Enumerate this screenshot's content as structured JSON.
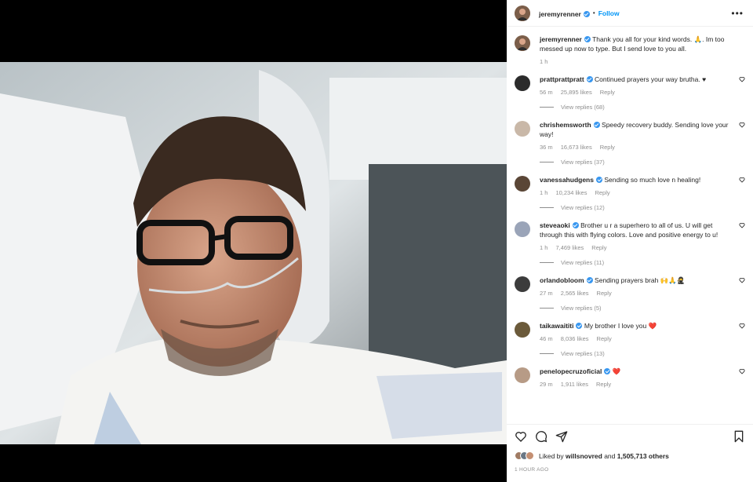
{
  "post": {
    "username": "jeremyrenner",
    "follow_label": "Follow",
    "separator": "•",
    "more_label": "•••",
    "caption": "Thank you all for your kind words. 🙏. Im too messed up now to type. But I send love to you all.",
    "caption_time": "1 h"
  },
  "comments": [
    {
      "user": "prattprattpratt",
      "text": "Continued prayers your way brutha. ♥",
      "time": "56 m",
      "likes": "25,895 likes",
      "reply": "Reply",
      "view_replies": "View replies (68)"
    },
    {
      "user": "chrishemsworth",
      "text": "Speedy recovery buddy. Sending love your way!",
      "time": "36 m",
      "likes": "16,673 likes",
      "reply": "Reply",
      "view_replies": "View replies (37)"
    },
    {
      "user": "vanessahudgens",
      "text": "Sending so much love n healing!",
      "time": "1 h",
      "likes": "10,234 likes",
      "reply": "Reply",
      "view_replies": "View replies (12)"
    },
    {
      "user": "steveaoki",
      "text": "Brother u r a superhero to all of us. U will get through this with flying colors. Love and positive energy to u!",
      "time": "1 h",
      "likes": "7,469 likes",
      "reply": "Reply",
      "view_replies": "View replies (11)"
    },
    {
      "user": "orlandobloom",
      "text": "Sending prayers brah 🙌🙏🥷",
      "time": "27 m",
      "likes": "2,565 likes",
      "reply": "Reply",
      "view_replies": "View replies (5)"
    },
    {
      "user": "taikawaititi",
      "text": "My brother I love you ❤️",
      "time": "46 m",
      "likes": "8,036 likes",
      "reply": "Reply",
      "view_replies": "View replies (13)"
    },
    {
      "user": "penelopecruzoficial",
      "text": "❤️",
      "time": "29 m",
      "likes": "1,911 likes",
      "reply": "Reply",
      "view_replies": ""
    }
  ],
  "likes": {
    "prefix": "Liked by",
    "user": "willsnovred",
    "mid": "and",
    "count": "1,505,713 others"
  },
  "timestamp": "1 HOUR AGO",
  "icons": {
    "like": "heart-icon",
    "comment": "comment-icon",
    "share": "share-icon",
    "save": "bookmark-icon"
  },
  "colors": {
    "accent": "#0095f6",
    "verified": "#3897f0",
    "muted": "#8e8e8e"
  }
}
